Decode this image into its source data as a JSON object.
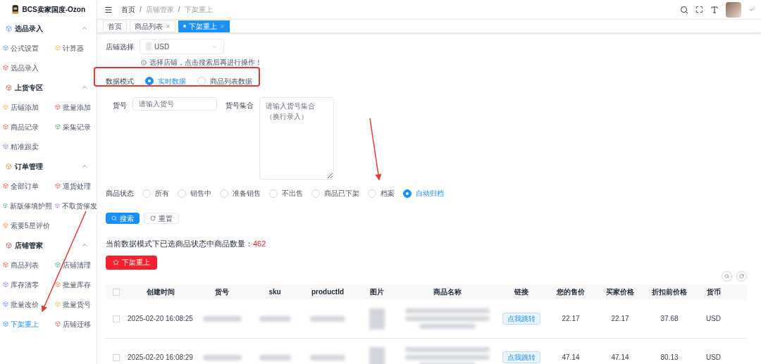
{
  "app": {
    "title": "BCS卖家国度-Ozon"
  },
  "sidebar": {
    "sections": [
      {
        "title": "选品录入",
        "items": [
          {
            "label": "公式设置",
            "selected": false
          },
          {
            "label": "计算器",
            "selected": false
          },
          {
            "label": "选品录入",
            "selected": false
          }
        ]
      },
      {
        "title": "上货专区",
        "items": [
          {
            "label": "店铺添加",
            "selected": false
          },
          {
            "label": "批量添加",
            "selected": false
          },
          {
            "label": "商品记录",
            "selected": false
          },
          {
            "label": "采集记录",
            "selected": false
          },
          {
            "label": "精准跟卖",
            "selected": false
          }
        ]
      },
      {
        "title": "订单管理",
        "items": [
          {
            "label": "全部订单",
            "selected": false
          },
          {
            "label": "退货处理",
            "selected": false
          },
          {
            "label": "新版催填护照",
            "selected": false
          },
          {
            "label": "不取货催发",
            "selected": false
          },
          {
            "label": "索要5星评价",
            "selected": false
          }
        ]
      },
      {
        "title": "店铺管家",
        "items": [
          {
            "label": "商品列表",
            "selected": false
          },
          {
            "label": "店铺清理",
            "selected": false
          },
          {
            "label": "库存清零",
            "selected": false
          },
          {
            "label": "批量库存",
            "selected": false
          },
          {
            "label": "批量改价",
            "selected": false
          },
          {
            "label": "批量货号",
            "selected": false
          },
          {
            "label": "下架重上",
            "selected": true
          },
          {
            "label": "店铺迁移",
            "selected": false
          }
        ]
      }
    ]
  },
  "breadcrumb": {
    "items": [
      "首页",
      "店铺管家",
      "下架重上"
    ],
    "separator": "/"
  },
  "tabs": [
    {
      "label": "首页",
      "selected": false,
      "closable": false
    },
    {
      "label": "商品列表",
      "selected": false,
      "closable": true
    },
    {
      "label": "下架重上",
      "selected": true,
      "closable": true
    }
  ],
  "form": {
    "store_label": "店铺选择",
    "store_value": "USD",
    "hint": "选择店铺，点击搜索后再进行操作！",
    "mode_label": "数据模式",
    "modes": [
      {
        "label": "实时数据",
        "selected": true
      },
      {
        "label": "商品列表数据",
        "selected": false
      }
    ],
    "sku_label": "货号",
    "sku_placeholder": "请输入货号",
    "sku_set_label": "货号集合",
    "sku_set_placeholder": "请输入货号集合（换行录入）",
    "status_label": "商品状态",
    "statuses": [
      {
        "label": "所有",
        "selected": false
      },
      {
        "label": "销售中",
        "selected": false
      },
      {
        "label": "准备销售",
        "selected": false
      },
      {
        "label": "不出售",
        "selected": false
      },
      {
        "label": "商品已下架",
        "selected": false
      },
      {
        "label": "档案",
        "selected": false
      },
      {
        "label": "自动归档",
        "selected": true
      }
    ],
    "search_button": "搜索",
    "reset_button": "重置"
  },
  "count": {
    "label": "当前数据模式下已选商品状态中商品数量：",
    "value": "462"
  },
  "action_button": "下架重上",
  "table": {
    "all_checked": false,
    "columns": [
      "创建时间",
      "货号",
      "sku",
      "productId",
      "图片",
      "商品名称",
      "链接",
      "您的售价",
      "买家价格",
      "折扣前价格",
      "货币"
    ],
    "rows": [
      {
        "checked": false,
        "created": "2025-02-20 16:08:25",
        "link": "点我跳转",
        "price": "22.17",
        "buyer_price": "22.17",
        "original_price": "37.68",
        "currency": "USD"
      },
      {
        "checked": false,
        "created": "2025-02-20 16:08:29",
        "link": "点我跳转",
        "price": "47.14",
        "buyer_price": "47.14",
        "original_price": "80.13",
        "currency": "USD"
      }
    ]
  }
}
